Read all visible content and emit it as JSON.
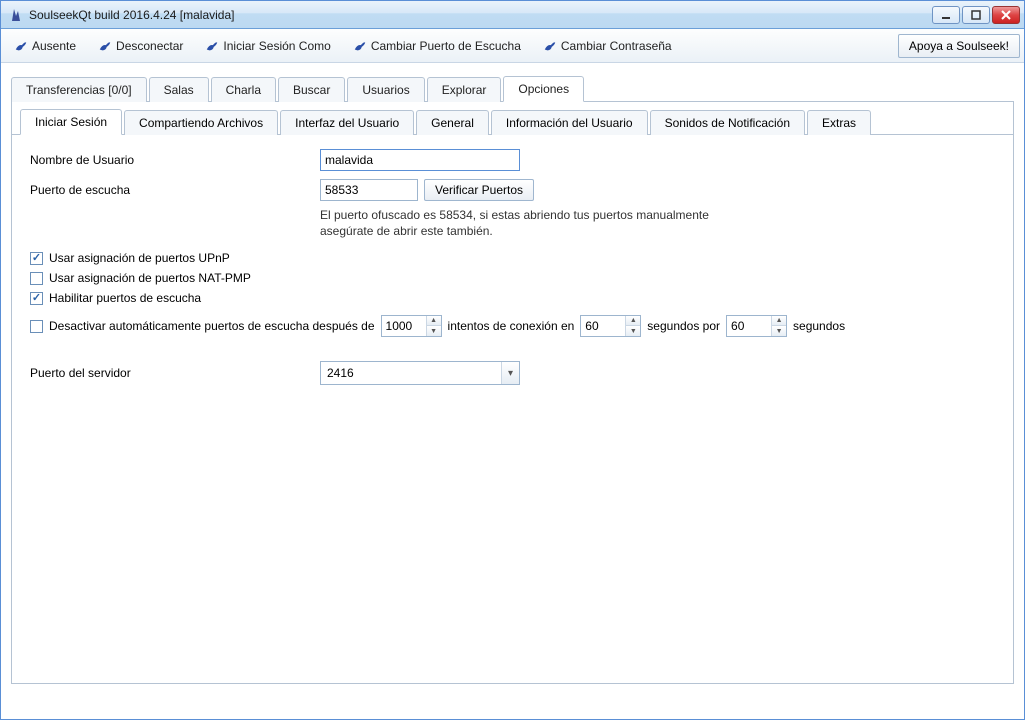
{
  "window": {
    "title": "SoulseekQt build 2016.4.24 [malavida]"
  },
  "toolbar": {
    "away": "Ausente",
    "disconnect": "Desconectar",
    "login_as": "Iniciar Sesión Como",
    "change_port": "Cambiar Puerto de Escucha",
    "change_password": "Cambiar Contraseña",
    "support": "Apoya a Soulseek!"
  },
  "tabs": {
    "transfers": "Transferencias [0/0]",
    "rooms": "Salas",
    "chat": "Charla",
    "search": "Buscar",
    "users": "Usuarios",
    "explore": "Explorar",
    "options": "Opciones"
  },
  "subtabs": {
    "login": "Iniciar Sesión",
    "sharing": "Compartiendo Archivos",
    "ui": "Interfaz del Usuario",
    "general": "General",
    "userinfo": "Información del Usuario",
    "sounds": "Sonidos de Notificación",
    "extras": "Extras"
  },
  "form": {
    "username_label": "Nombre de Usuario",
    "username_value": "malavida",
    "port_label": "Puerto de escucha",
    "port_value": "58533",
    "verify_ports": "Verificar Puertos",
    "port_hint": "El puerto ofuscado es 58534, si estas abriendo tus puertos manualmente asegúrate de abrir este también.",
    "upnp_label": "Usar asignación de puertos UPnP",
    "natpmp_label": "Usar asignación de puertos NAT-PMP",
    "enable_ports_label": "Habilitar puertos de escucha",
    "auto_disable_prefix": "Desactivar automáticamente puertos de escucha después de",
    "auto_disable_attempts": "1000",
    "auto_disable_mid1": "intentos de conexión en",
    "auto_disable_seconds1": "60",
    "auto_disable_mid2": "segundos por",
    "auto_disable_seconds2": "60",
    "auto_disable_suffix": "segundos",
    "server_port_label": "Puerto del servidor",
    "server_port_value": "2416"
  }
}
